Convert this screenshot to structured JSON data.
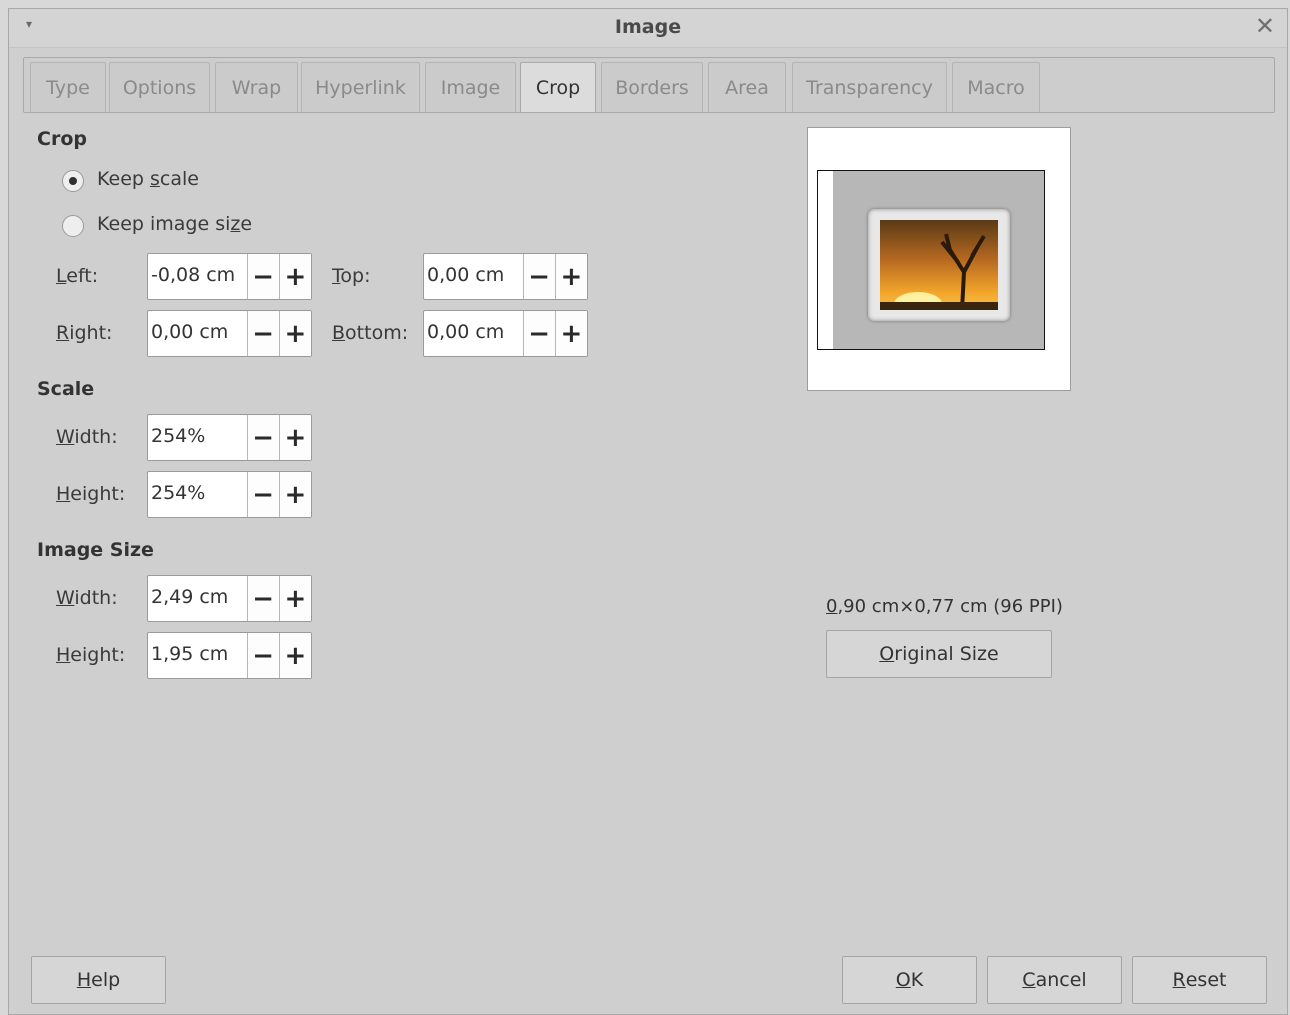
{
  "window": {
    "title": "Image"
  },
  "tabs": [
    {
      "label": "Type"
    },
    {
      "label": "Options"
    },
    {
      "label": "Wrap"
    },
    {
      "label": "Hyperlink"
    },
    {
      "label": "Image"
    },
    {
      "label": "Crop",
      "active": true
    },
    {
      "label": "Borders"
    },
    {
      "label": "Area"
    },
    {
      "label": "Transparency"
    },
    {
      "label": "Macro"
    }
  ],
  "crop": {
    "title": "Crop",
    "keep_scale": {
      "label_pre": "Keep ",
      "label_u": "s",
      "label_post": "cale",
      "checked": true
    },
    "keep_image_size": {
      "label_pre": "Keep image si",
      "label_u": "z",
      "label_post": "e",
      "checked": false
    },
    "left": {
      "label_u": "L",
      "label_rest": "eft:",
      "value": "-0,08 cm"
    },
    "right": {
      "label_u": "R",
      "label_rest": "ight:",
      "value": "0,00 cm"
    },
    "top": {
      "label_u": "T",
      "label_rest": "op:",
      "value": "0,00 cm"
    },
    "bottom": {
      "label_u": "B",
      "label_rest": "ottom:",
      "value": "0,00 cm"
    }
  },
  "scale": {
    "title": "Scale",
    "width": {
      "label_u": "W",
      "label_rest": "idth:",
      "value": "254%"
    },
    "height": {
      "label_u": "H",
      "label_rest": "eight:",
      "value": "254%"
    }
  },
  "image_size": {
    "title": "Image Size",
    "width": {
      "label_u": "W",
      "label_rest": "idth:",
      "value": "2,49 cm"
    },
    "height": {
      "label_u": "H",
      "label_rest": "eight:",
      "value": "1,95 cm"
    }
  },
  "original": {
    "info_u": "0",
    "info_rest": ",90 cm×0,77 cm (96 PPI)",
    "button_u": "O",
    "button_rest": "riginal Size"
  },
  "spin_buttons": {
    "minus": "−",
    "plus": "+"
  },
  "icons": {
    "menu": "▾",
    "close": "✕"
  },
  "buttons": {
    "help": {
      "u": "H",
      "rest": "elp"
    },
    "ok": {
      "u": "O",
      "rest": "K"
    },
    "cancel": {
      "u": "C",
      "rest": "ancel"
    },
    "reset": {
      "u": "R",
      "rest": "eset"
    }
  }
}
